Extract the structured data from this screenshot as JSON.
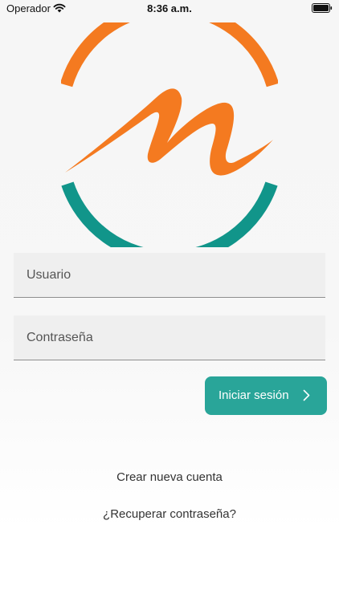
{
  "status_bar": {
    "carrier": "Operador",
    "time": "8:36 a.m.",
    "wifi_icon": "wifi-icon",
    "battery_icon": "battery-icon"
  },
  "logo": {
    "icon": "brand-logo",
    "colors": {
      "orange": "#f47a20",
      "teal": "#11958a"
    }
  },
  "form": {
    "username_placeholder": "Usuario",
    "username_value": "",
    "password_placeholder": "Contraseña",
    "password_value": "",
    "login_label": "Iniciar sesión",
    "login_icon": "chevron-right-icon",
    "accent_color": "#29a599"
  },
  "links": {
    "create_account": "Crear nueva cuenta",
    "recover_password": "¿Recuperar contraseña?"
  }
}
